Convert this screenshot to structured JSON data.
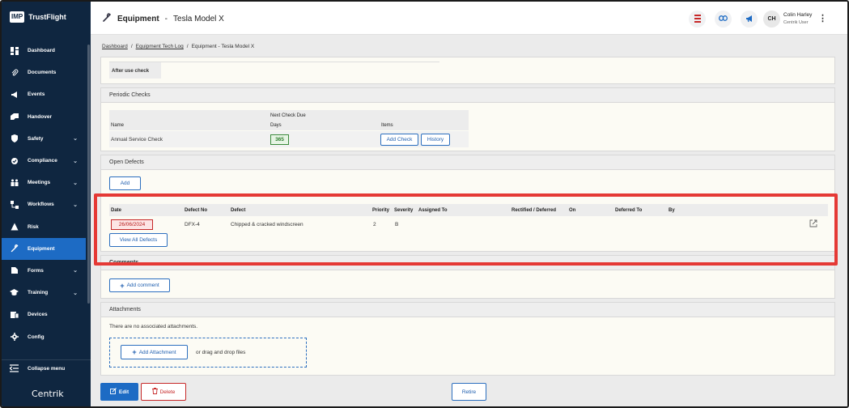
{
  "sidebar": {
    "logo_box": "IMP",
    "logo_text": "TrustFlight",
    "items": [
      {
        "label": "Dashboard",
        "icon": "dashboard-icon",
        "chevron": false
      },
      {
        "label": "Documents",
        "icon": "paperclip-icon",
        "chevron": false
      },
      {
        "label": "Events",
        "icon": "megaphone-icon",
        "chevron": false
      },
      {
        "label": "Handover",
        "icon": "handover-icon",
        "chevron": false
      },
      {
        "label": "Safety",
        "icon": "shield-icon",
        "chevron": true
      },
      {
        "label": "Compliance",
        "icon": "compliance-icon",
        "chevron": true
      },
      {
        "label": "Meetings",
        "icon": "meetings-icon",
        "chevron": true
      },
      {
        "label": "Workflows",
        "icon": "workflows-icon",
        "chevron": true
      },
      {
        "label": "Risk",
        "icon": "warning-icon",
        "chevron": false
      },
      {
        "label": "Equipment",
        "icon": "wrench-icon",
        "chevron": false,
        "active": true
      },
      {
        "label": "Forms",
        "icon": "forms-icon",
        "chevron": true
      },
      {
        "label": "Training",
        "icon": "graduation-cap-icon",
        "chevron": true
      },
      {
        "label": "Devices",
        "icon": "devices-icon",
        "chevron": false
      },
      {
        "label": "Config",
        "icon": "config-icon",
        "chevron": false
      }
    ],
    "collapse_label": "Collapse menu",
    "brand": "Centrik"
  },
  "header": {
    "section": "Equipment",
    "separator": "-",
    "record": "Tesla Model X",
    "user_initials": "CH",
    "user_name": "Colin Harley",
    "user_role": "Centrik User"
  },
  "breadcrumb": {
    "items": [
      "Dashboard",
      "Equipment Tech Log",
      "Equipment - Tesla Model X"
    ],
    "separator": "/"
  },
  "after_use": {
    "label": "After use check"
  },
  "periodic_checks": {
    "title": "Periodic Checks",
    "group_header": "Next Check Due",
    "columns": [
      "Name",
      "Days",
      "Items"
    ],
    "row": {
      "name": "Annual Service Check",
      "days": "365"
    },
    "add_check_label": "Add Check",
    "history_label": "History"
  },
  "open_defects": {
    "title": "Open Defects",
    "add_label": "Add",
    "columns": [
      "Date",
      "Defect No",
      "Defect",
      "Priority",
      "Severity",
      "Assigned To",
      "Rectified / Deferred",
      "On",
      "Deferred To",
      "By"
    ],
    "row": {
      "date": "26/06/2024",
      "defect_no": "DFX-4",
      "defect": "Chipped & cracked windscreen",
      "priority": "2",
      "severity": "B"
    },
    "view_all_label": "View All Defects"
  },
  "comments": {
    "title": "Comments",
    "add_label": "Add comment"
  },
  "attachments": {
    "title": "Attachments",
    "empty_text": "There are no associated attachments.",
    "add_label": "Add Attachment",
    "drop_text": "or drag and drop files"
  },
  "footer": {
    "edit_label": "Edit",
    "delete_label": "Delete",
    "retire_label": "Retire"
  },
  "colors": {
    "sidebar_bg": "#0f2640",
    "accent": "#1d6bc4",
    "highlight": "#e53935",
    "danger": "#c62828",
    "success": "#2e7d2e"
  }
}
